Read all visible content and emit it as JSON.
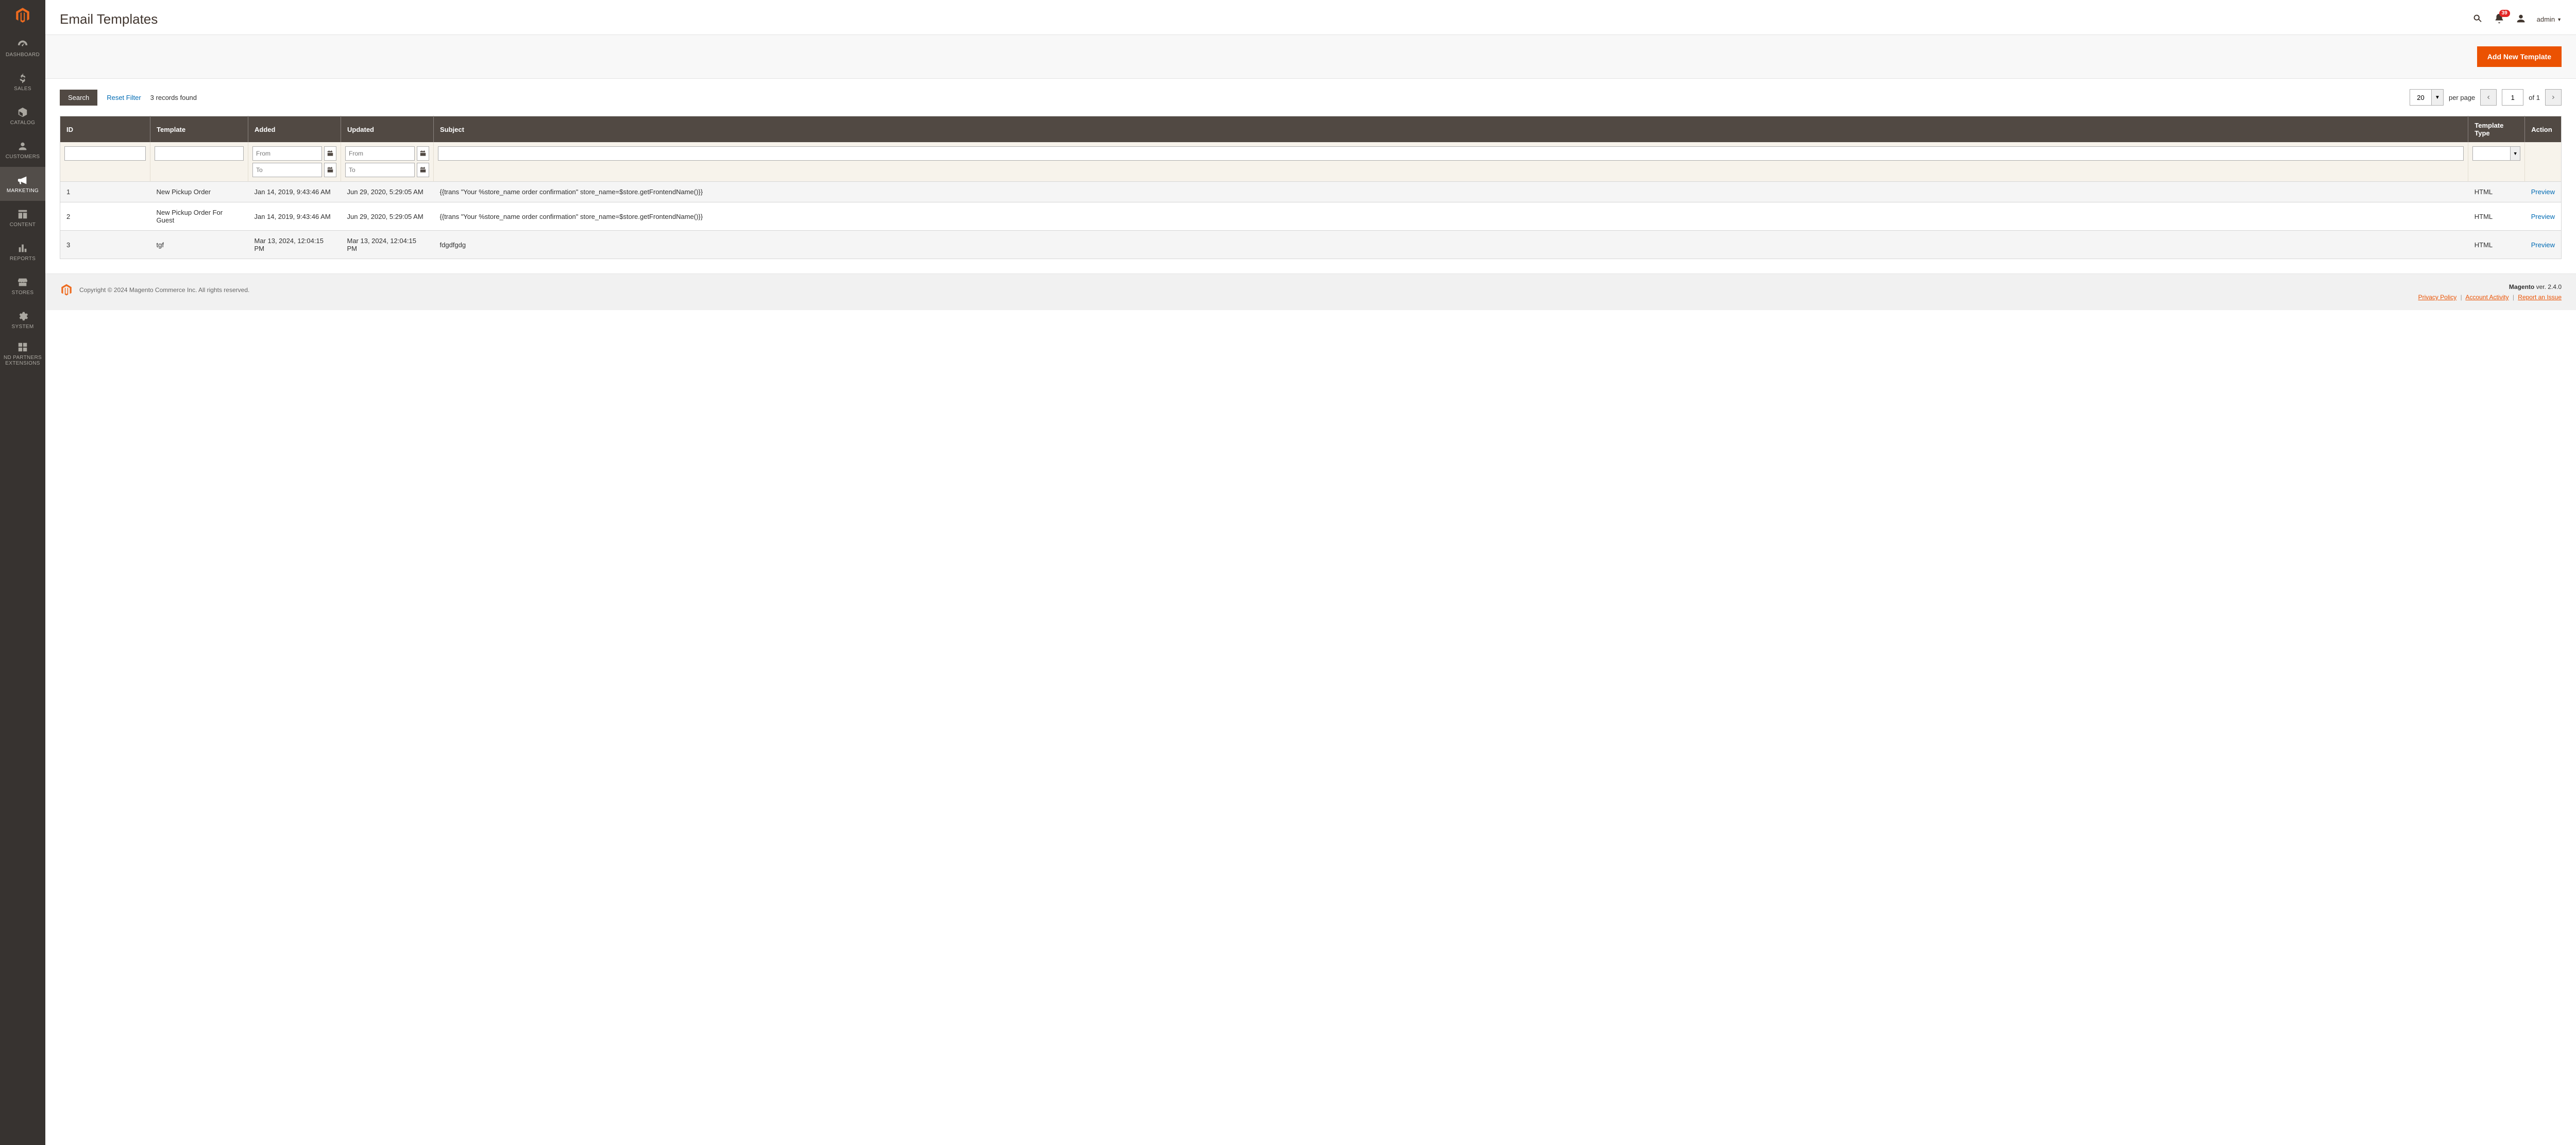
{
  "colors": {
    "accent": "#eb5202",
    "link": "#006bb4",
    "sidebar": "#373330",
    "thead": "#514943"
  },
  "sidebar": {
    "items": [
      {
        "label": "DASHBOARD",
        "icon": "gauge"
      },
      {
        "label": "SALES",
        "icon": "dollar"
      },
      {
        "label": "CATALOG",
        "icon": "box"
      },
      {
        "label": "CUSTOMERS",
        "icon": "person"
      },
      {
        "label": "MARKETING",
        "icon": "megaphone",
        "active": true
      },
      {
        "label": "CONTENT",
        "icon": "layout"
      },
      {
        "label": "REPORTS",
        "icon": "bars"
      },
      {
        "label": "STORES",
        "icon": "store"
      },
      {
        "label": "SYSTEM",
        "icon": "gear"
      },
      {
        "label": "ND PARTNERS EXTENSIONS",
        "icon": "blocks"
      }
    ]
  },
  "header": {
    "title": "Email Templates",
    "notifications": "39",
    "username": "admin"
  },
  "actionbar": {
    "add_label": "Add New Template"
  },
  "controls": {
    "search_label": "Search",
    "reset_label": "Reset Filter",
    "records_found": "3 records found",
    "per_page_value": "20",
    "per_page_label": "per page",
    "page_value": "1",
    "page_total_prefix": "of",
    "page_total": "1"
  },
  "table": {
    "headers": {
      "id": "ID",
      "template": "Template",
      "added": "Added",
      "updated": "Updated",
      "subject": "Subject",
      "type": "Template Type",
      "action": "Action"
    },
    "filters": {
      "from_placeholder": "From",
      "to_placeholder": "To"
    },
    "rows": [
      {
        "id": "1",
        "template": "New Pickup Order",
        "added": "Jan 14, 2019, 9:43:46 AM",
        "updated": "Jun 29, 2020, 5:29:05 AM",
        "subject": "{{trans \"Your %store_name order confirmation\" store_name=$store.getFrontendName()}}",
        "type": "HTML",
        "action": "Preview"
      },
      {
        "id": "2",
        "template": "New Pickup Order For Guest",
        "added": "Jan 14, 2019, 9:43:46 AM",
        "updated": "Jun 29, 2020, 5:29:05 AM",
        "subject": "{{trans \"Your %store_name order confirmation\" store_name=$store.getFrontendName()}}",
        "type": "HTML",
        "action": "Preview"
      },
      {
        "id": "3",
        "template": "tgf",
        "added": "Mar 13, 2024, 12:04:15 PM",
        "updated": "Mar 13, 2024, 12:04:15 PM",
        "subject": "fdgdfgdg",
        "type": "HTML",
        "action": "Preview"
      }
    ]
  },
  "footer": {
    "copyright": "Copyright © 2024 Magento Commerce Inc. All rights reserved.",
    "product": "Magento",
    "version_prefix": "ver.",
    "version": "2.4.0",
    "links": {
      "privacy": "Privacy Policy",
      "activity": "Account Activity",
      "report": "Report an Issue"
    }
  }
}
